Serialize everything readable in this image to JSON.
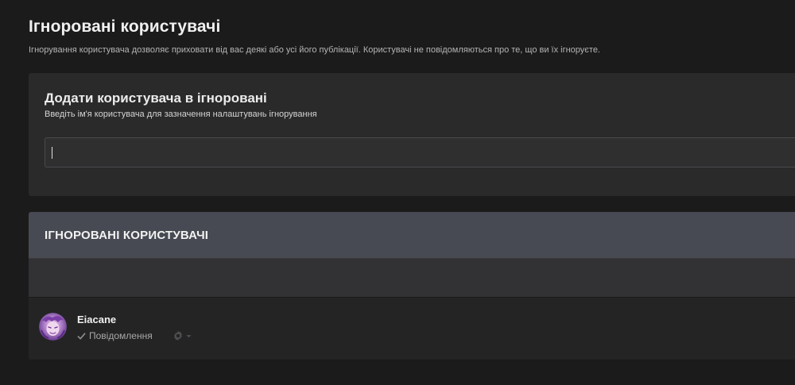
{
  "page": {
    "title": "Ігноровані користувачі",
    "description": "Ігнорування користувача дозволяє приховати від вас деякі або усі його публікації. Користувачі не повідомляються про те, що ви їх ігноруєте."
  },
  "add_form": {
    "title": "Додати користувача в ігноровані",
    "subtitle": "Введіть ім'я користувача для зазначення налаштувань ігнорування",
    "input_value": "",
    "input_placeholder": ""
  },
  "ignored_list": {
    "header": "ІГНОРОВАНІ КОРИСТУВАЧІ",
    "users": [
      {
        "name": "Eiacane",
        "ignore_type": "Повідомлення",
        "avatar_icon": "avatar-image",
        "menu_icon": "gear-icon"
      }
    ]
  },
  "colors": {
    "background": "#1b1b1c",
    "panel": "#2a2a2b",
    "list_header": "#474a52",
    "text_primary": "#f0f0f0",
    "text_muted": "#a8a8a8"
  }
}
